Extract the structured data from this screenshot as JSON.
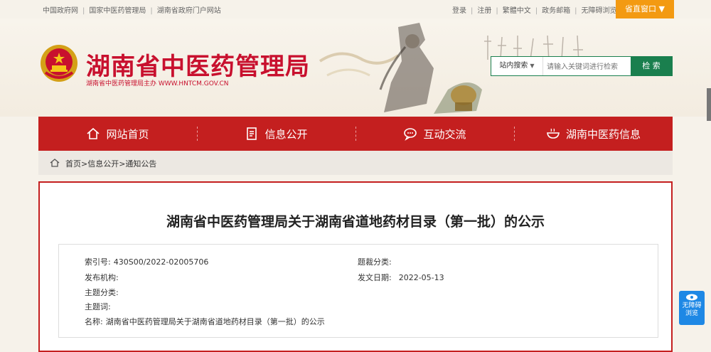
{
  "topbar": {
    "left_links": [
      "中国政府网",
      "国家中医药管理局",
      "湖南省政府门户网站"
    ],
    "right_links": [
      "登录",
      "注册",
      "繁體中文",
      "政务邮箱",
      "无障碍浏览"
    ],
    "province_portal": "省直窗口 ▼"
  },
  "header": {
    "title": "湖南省中医药管理局",
    "subtitle": "湖南省中医药管理局主办 WWW.HNTCM.GOV.CN",
    "search": {
      "scope": "站内搜索",
      "placeholder": "请输入关键词进行检索",
      "button": "检 索"
    }
  },
  "nav": {
    "items": [
      {
        "label": "网站首页",
        "icon": "home-icon"
      },
      {
        "label": "信息公开",
        "icon": "document-icon"
      },
      {
        "label": "互动交流",
        "icon": "chat-icon"
      },
      {
        "label": "湖南中医药信息",
        "icon": "bowl-icon"
      }
    ]
  },
  "breadcrumb": {
    "trail": "首页>信息公开>通知公告"
  },
  "article": {
    "title": "湖南省中医药管理局关于湖南省道地药材目录（第一批）的公示",
    "meta": {
      "index_label": "索引号:",
      "index_value": "430S00/2022-02005706",
      "genre_label": "题裁分类:",
      "genre_value": "",
      "publisher_label": "发布机构:",
      "publisher_value": "",
      "date_label": "发文日期:",
      "date_value": "2022-05-13",
      "topic_label": "主题分类:",
      "keyword_label": "主题词:",
      "name_label": "名称:",
      "name_value": "湖南省中医药管理局关于湖南省道地药材目录（第一批）的公示"
    }
  },
  "a11y_widget": {
    "line1": "无障碍",
    "line2": "浏览"
  },
  "colors": {
    "brand_red": "#c41f1f",
    "search_green": "#1a7f4e",
    "portal_orange": "#f39a12",
    "a11y_blue": "#1e88e5"
  }
}
